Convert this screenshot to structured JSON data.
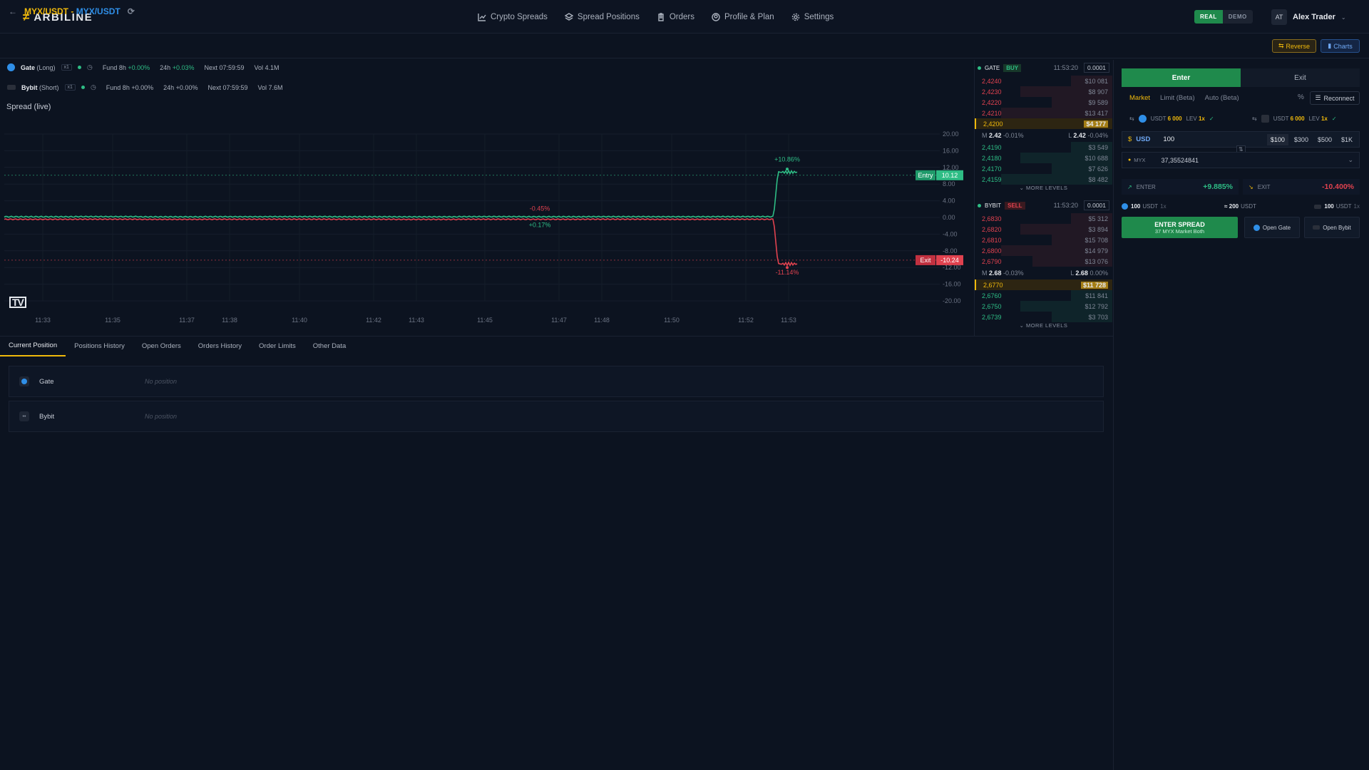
{
  "app": {
    "logo_mark": "≠",
    "name": "ARBILINE"
  },
  "nav": {
    "items": [
      {
        "label": "Crypto Spreads",
        "icon": "chart-line-icon"
      },
      {
        "label": "Spread Positions",
        "icon": "layers-icon"
      },
      {
        "label": "Orders",
        "icon": "clipboard-icon"
      },
      {
        "label": "Profile & Plan",
        "icon": "user-circle-icon"
      },
      {
        "label": "Settings",
        "icon": "gear-icon"
      }
    ]
  },
  "mode": {
    "real": "REAL",
    "demo": "DEMO"
  },
  "user": {
    "initials": "AT",
    "name": "Alex Trader"
  },
  "pair": {
    "left": "MYX/USDT",
    "sep": " - ",
    "right": "MYX/USDT"
  },
  "actions": {
    "reverse": "Reverse",
    "charts": "Charts"
  },
  "exchanges": [
    {
      "name": "Gate",
      "side": "(Long)",
      "lev": "x1",
      "fund": "Fund 8h",
      "fund_val": "+0.00%",
      "h24": "24h",
      "h24_val": "+0.03%",
      "next": "Next 07:59:59",
      "vol": "Vol 4.1M"
    },
    {
      "name": "Bybit",
      "side": "(Short)",
      "lev": "x1",
      "fund": "Fund 8h",
      "fund_val": "+0.00%",
      "h24": "24h",
      "h24_val": "+0.00%",
      "next": "Next 07:59:59",
      "vol": "Vol 7.6M"
    }
  ],
  "chart": {
    "title": "Spread (live)",
    "entry_label": "Entry",
    "entry_val": "10.12",
    "exit_label": "Exit",
    "exit_val": "-10.24",
    "ann": {
      "a1": "-0.45%",
      "a2": "+0.17%",
      "a3": "+10.86%",
      "a4": "-11.14%"
    },
    "logo": "TV"
  },
  "chart_data": {
    "type": "line",
    "x": [
      "11:33",
      "11:35",
      "11:37",
      "11:38",
      "11:40",
      "11:42",
      "11:43",
      "11:45",
      "11:47",
      "11:48",
      "11:50",
      "11:52",
      "11:53"
    ],
    "y_ticks": [
      "20.00",
      "16.00",
      "12.00",
      "8.00",
      "4.00",
      "0.00",
      "-4.00",
      "-8.00",
      "-12.00",
      "-16.00",
      "-20.00"
    ],
    "ylim": [
      -20,
      20
    ],
    "series": [
      {
        "name": "Entry",
        "color": "#2ebd85",
        "values": [
          0.17,
          0.2,
          0.15,
          0.18,
          0.2,
          0.17,
          0.15,
          0.2,
          0.17,
          0.19,
          0.18,
          0.2,
          10.86
        ]
      },
      {
        "name": "Exit",
        "color": "#e0424f",
        "values": [
          -0.45,
          -0.42,
          -0.46,
          -0.44,
          -0.43,
          -0.45,
          -0.47,
          -0.44,
          -0.45,
          -0.43,
          -0.46,
          -0.44,
          -11.14
        ]
      }
    ],
    "entry_line": 10.12,
    "exit_line": -10.24
  },
  "orderbook": {
    "gate": {
      "ex": "GATE",
      "side": "BUY",
      "time": "11:53:20",
      "step": "0.0001",
      "asks": [
        [
          "2,4240",
          "$10 081"
        ],
        [
          "2,4230",
          "$8 907"
        ],
        [
          "2,4220",
          "$9 589"
        ],
        [
          "2,4210",
          "$13 417"
        ]
      ],
      "best": [
        "2,4200",
        "$4 177"
      ],
      "mid": {
        "m": "M",
        "mval": "2.42",
        "mchg": "-0.01%",
        "l": "L",
        "lval": "2.42",
        "lchg": "-0.04%"
      },
      "bids": [
        [
          "2,4190",
          "$3 549"
        ],
        [
          "2,4180",
          "$10 688"
        ],
        [
          "2,4170",
          "$7 626"
        ],
        [
          "2,4159",
          "$8 482"
        ]
      ]
    },
    "bybit": {
      "ex": "BYBIT",
      "side": "SELL",
      "time": "11:53:20",
      "step": "0.0001",
      "asks": [
        [
          "2,6830",
          "$5 312"
        ],
        [
          "2,6820",
          "$3 894"
        ],
        [
          "2,6810",
          "$15 708"
        ],
        [
          "2,6800",
          "$14 979"
        ],
        [
          "2,6790",
          "$13 076"
        ]
      ],
      "mid": {
        "m": "M",
        "mval": "2.68",
        "mchg": "-0.03%",
        "l": "L",
        "lval": "2.68",
        "lchg": "0.00%"
      },
      "best": [
        "2,6770",
        "$11 728"
      ],
      "bids": [
        [
          "2,6760",
          "$11 841"
        ],
        [
          "2,6750",
          "$12 792"
        ],
        [
          "2,6739",
          "$3 703"
        ]
      ]
    },
    "more": "MORE LEVELS"
  },
  "trade": {
    "tab_enter": "Enter",
    "tab_exit": "Exit",
    "types": {
      "market": "Market",
      "limit": "Limit (Beta)",
      "auto": "Auto (Beta)"
    },
    "reconnect": "Reconnect",
    "bal_left": {
      "cur": "USDT",
      "val": "6 000",
      "lev": "LEV",
      "levv": "1x"
    },
    "bal_right": {
      "cur": "USDT",
      "val": "6 000",
      "lev": "LEV",
      "levv": "1x"
    },
    "amount": {
      "cur": "USD",
      "value": "100"
    },
    "presets": [
      "$100",
      "$300",
      "$500",
      "$1K"
    ],
    "qty": {
      "coin": "MYX",
      "value": "37,35524841"
    },
    "enter": {
      "label": "ENTER",
      "val": "+9.885%"
    },
    "exit": {
      "label": "EXIT",
      "val": "-10.400%"
    },
    "sum": {
      "left": "100",
      "left_cur": "USDT",
      "left_lev": "1x",
      "mid": "≈ 200",
      "mid_cur": "USDT",
      "right": "100",
      "right_cur": "USDT",
      "right_lev": "1x"
    },
    "btn": {
      "title": "ENTER SPREAD",
      "sub": "37 MYX Market Both"
    },
    "open_gate": "Open Gate",
    "open_bybit": "Open Bybit"
  },
  "bottom": {
    "tabs": [
      "Current Position",
      "Positions History",
      "Open Orders",
      "Orders History",
      "Order Limits",
      "Other Data"
    ],
    "rows": [
      {
        "ex": "Gate",
        "val": "No position"
      },
      {
        "ex": "Bybit",
        "val": "No position"
      }
    ]
  }
}
